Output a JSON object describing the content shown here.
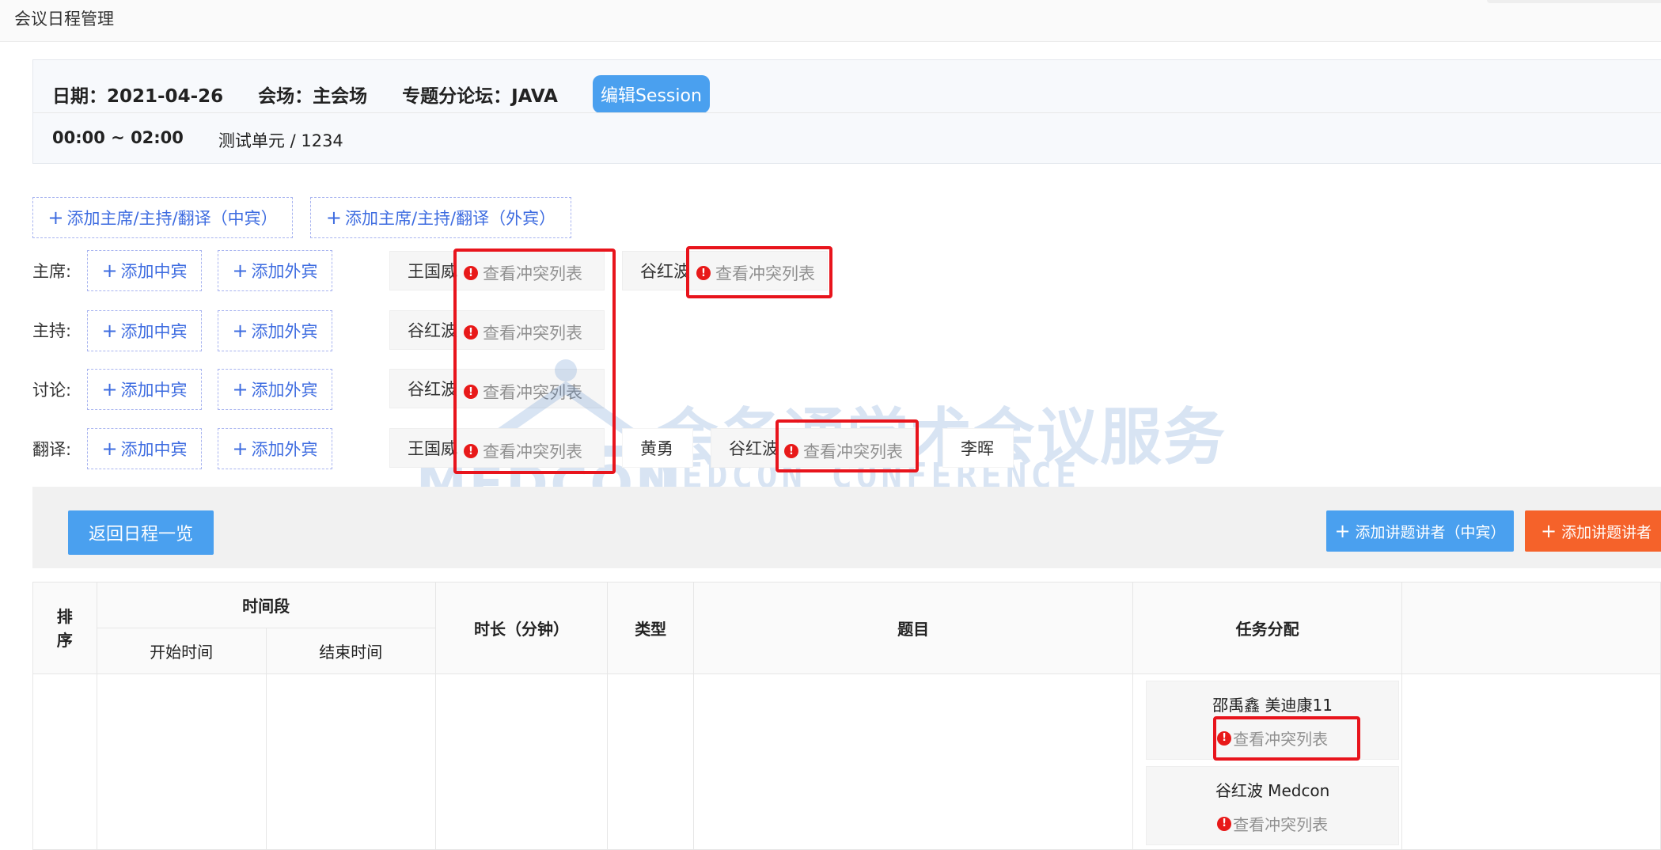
{
  "header": {
    "title": "会议日程管理"
  },
  "session": {
    "date": "日期：2021-04-26",
    "venue": "会场：主会场",
    "forum": "专题分论坛：JAVA",
    "edit_button": "编辑Session",
    "time": "00:00 ~ 02:00",
    "unit": "测试单元 / 1234"
  },
  "top_actions": {
    "add_cn": "添加主席/主持/翻译（中宾）",
    "add_foreign": "添加主席/主持/翻译（外宾）"
  },
  "roles": {
    "add_cn_label": "添加中宾",
    "add_foreign_label": "添加外宾",
    "conflict_label": "查看冲突列表",
    "chair": {
      "label": "主席:",
      "people": [
        "王国威",
        "谷红波"
      ]
    },
    "host": {
      "label": "主持:",
      "people": [
        "谷红波"
      ]
    },
    "discussion": {
      "label": "讨论:",
      "people": [
        "谷红波"
      ]
    },
    "translation": {
      "label": "翻译:",
      "people": [
        "王国威",
        "黄勇",
        "谷红波",
        "李晖"
      ]
    }
  },
  "watermark": {
    "cn": "会务通学术会议服务平台",
    "en": "MEDCON CONFERENCE SERVICE PLATFORM",
    "logo": "MEDCON"
  },
  "toolbar": {
    "back": "返回日程一览",
    "add_speaker_cn": "添加讲题讲者（中宾）",
    "add_speaker_foreign": "添加讲题讲者（外"
  },
  "table": {
    "col_order": "排序",
    "col_period": "时间段",
    "col_start": "开始时间",
    "col_end": "结束时间",
    "col_duration": "时长（分钟）",
    "col_type": "类型",
    "col_topic": "题目",
    "col_task": "任务分配",
    "tasks": [
      {
        "name": "邵禹鑫 美迪康11",
        "conflict": "查看冲突列表"
      },
      {
        "name": "谷红波 Medcon",
        "conflict": "查看冲突列表"
      }
    ]
  },
  "colors": {
    "primary": "#4aa0ef",
    "danger": "#e8141c",
    "orange": "#f5622a"
  }
}
